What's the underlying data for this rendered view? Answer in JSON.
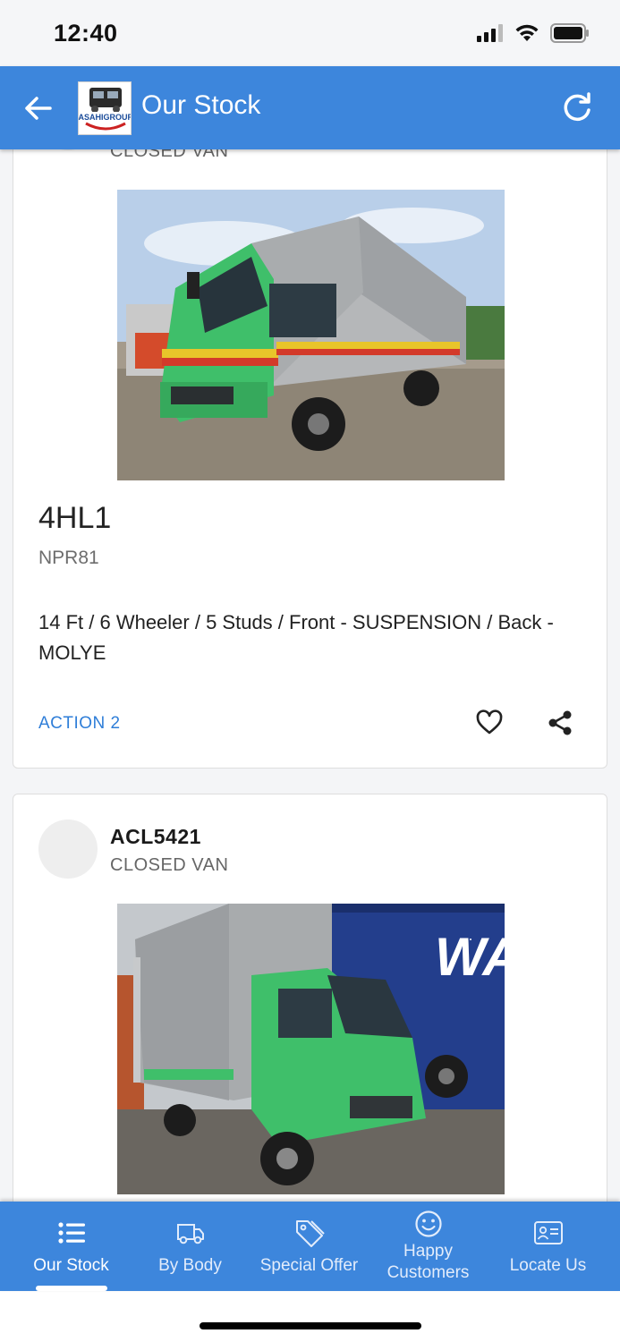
{
  "status_bar": {
    "time": "12:40"
  },
  "app_bar": {
    "title": "Our Stock",
    "logo_text": "ASAHIGROUP"
  },
  "cards": [
    {
      "code": "",
      "type": "CLOSED VAN",
      "model": "4HL1",
      "submodel": "NPR81",
      "description": "14 Ft / 6 Wheeler / 5 Studs / Front - SUSPENSION / Back - MOLYE",
      "action_label": "ACTION 2"
    },
    {
      "code": "ACL5421",
      "type": "CLOSED VAN"
    }
  ],
  "bottom_nav": {
    "items": [
      {
        "label": "Our Stock",
        "icon": "list-icon",
        "active": true
      },
      {
        "label": "By Body",
        "icon": "truck-icon",
        "active": false
      },
      {
        "label": "Special Offer",
        "icon": "tag-icon",
        "active": false
      },
      {
        "label": "Happy Customers",
        "icon": "smile-icon",
        "active": false
      },
      {
        "label": "Locate Us",
        "icon": "contact-card-icon",
        "active": false
      }
    ]
  },
  "colors": {
    "primary": "#3d86dc",
    "action": "#2f7ed8",
    "truck_green": "#3fbf6a"
  }
}
